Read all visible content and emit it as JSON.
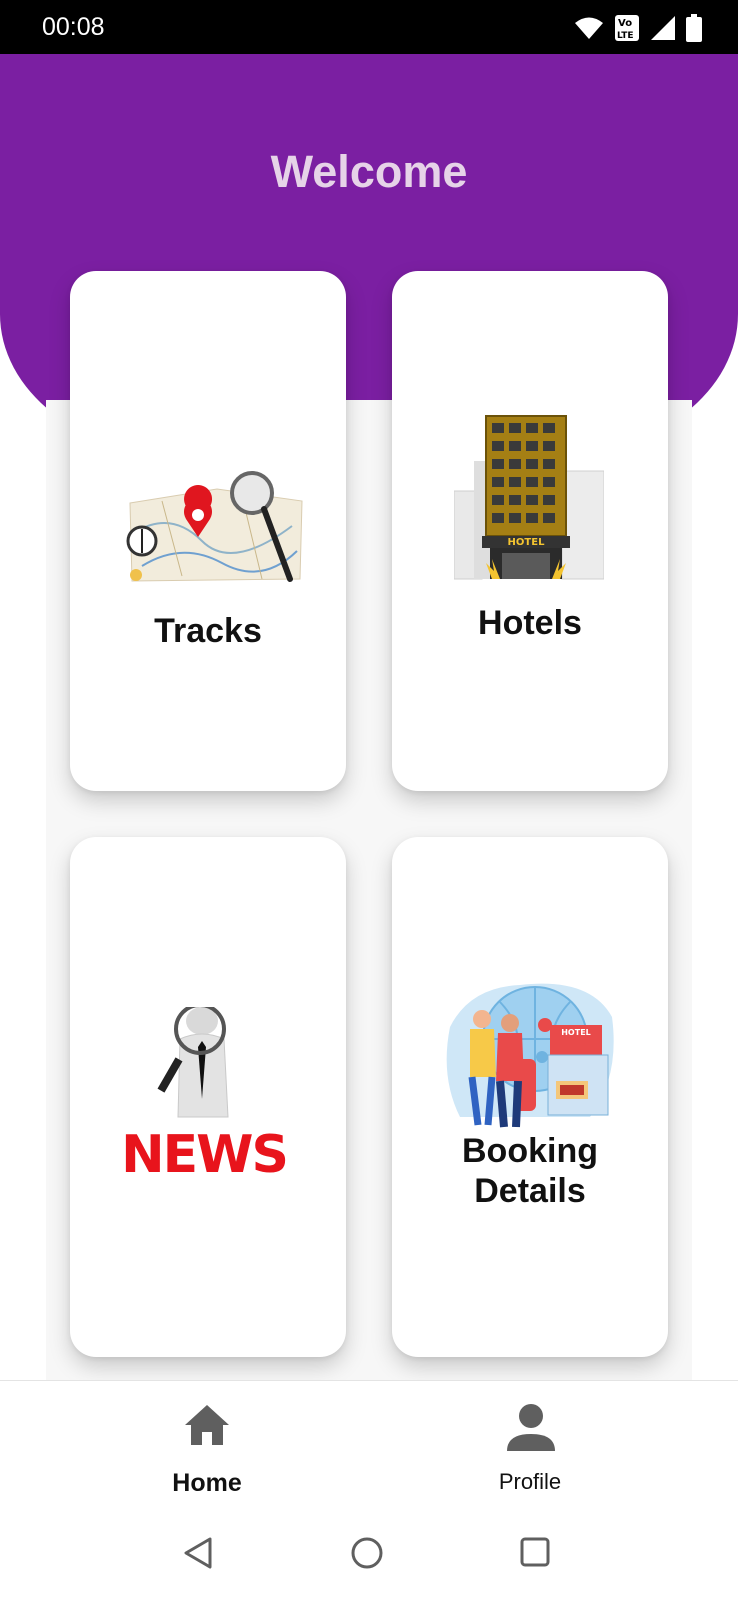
{
  "status_bar": {
    "time": "00:08",
    "icons": [
      "wifi-icon",
      "volte-icon",
      "signal-icon",
      "battery-icon"
    ],
    "volte_top": "Vo",
    "volte_bottom": "LTE"
  },
  "header": {
    "title": "Welcome",
    "color": "#7b1fa2",
    "title_color": "#e6d3e8"
  },
  "cards": {
    "tracks": {
      "label": "Tracks",
      "icon": "map-magnifier-illustration"
    },
    "hotels": {
      "label": "Hotels",
      "icon": "hotel-building-illustration",
      "sign": "HOTEL"
    },
    "news": {
      "label": "",
      "icon": "news-magnifier-illustration",
      "image_text": "NEWS"
    },
    "booking": {
      "label_line1": "Booking",
      "label_line2": "Details",
      "icon": "travel-booking-illustration",
      "sign": "HOTEL"
    }
  },
  "bottom_nav": {
    "home": {
      "label": "Home",
      "icon": "home-icon",
      "active": true
    },
    "profile": {
      "label": "Profile",
      "icon": "person-icon",
      "active": false
    }
  },
  "system_nav": {
    "icons": [
      "back-icon",
      "home-circle-icon",
      "recents-icon"
    ]
  }
}
